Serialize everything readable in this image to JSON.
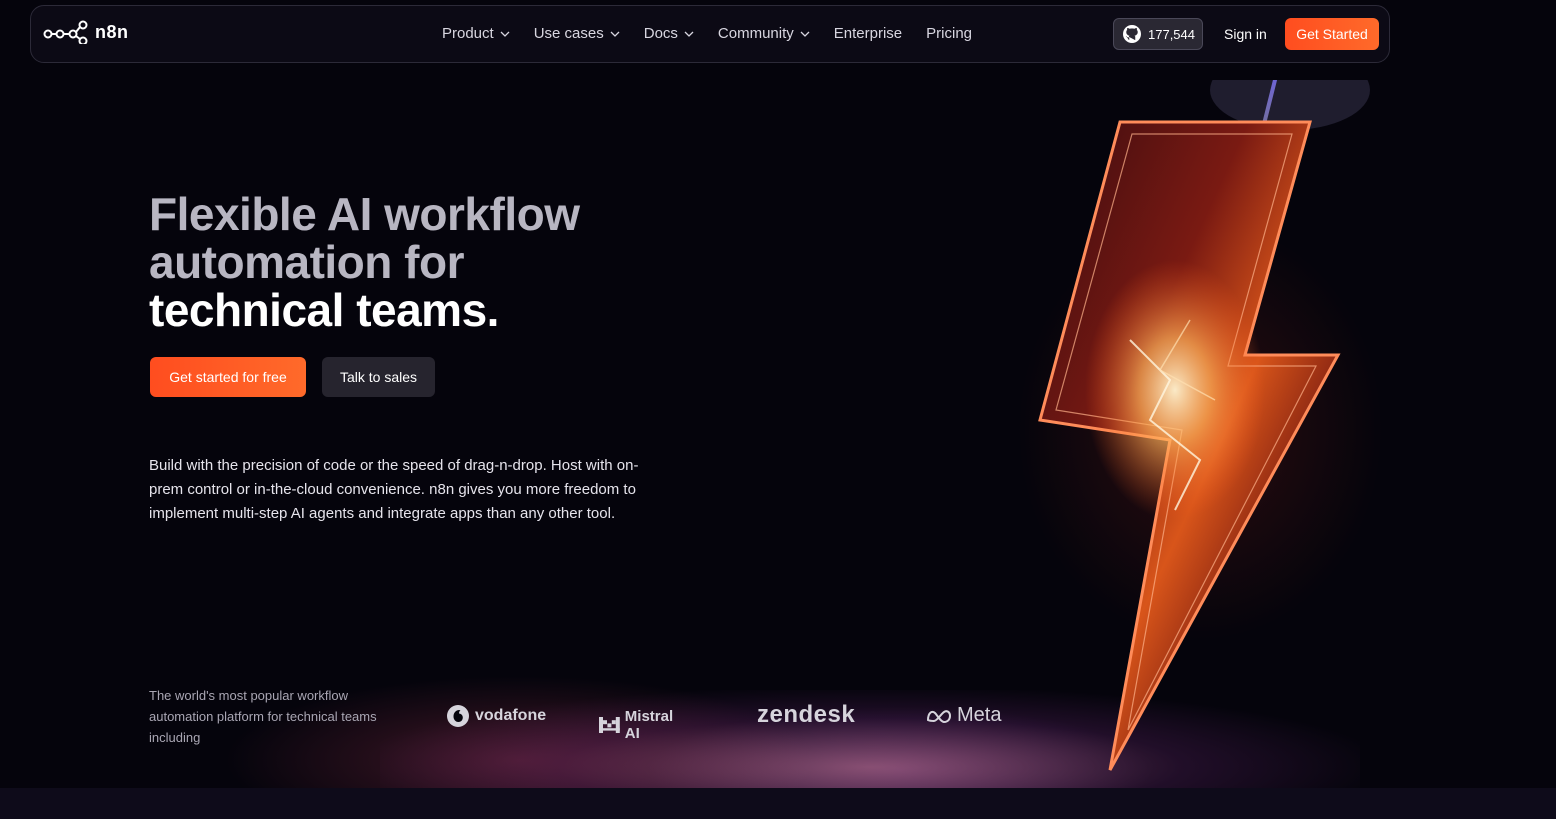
{
  "nav": {
    "logo_text": "n8n",
    "links": [
      {
        "label": "Product"
      },
      {
        "label": "Use cases"
      },
      {
        "label": "Docs"
      },
      {
        "label": "Community"
      },
      {
        "label": "Enterprise"
      },
      {
        "label": "Pricing"
      }
    ],
    "github_stars": "177,544",
    "sign_in": "Sign in",
    "get_started": "Get Started"
  },
  "hero": {
    "headline_line1": "Flexible AI workflow",
    "headline_line2": "automation for",
    "headline_line3": "technical teams.",
    "cta_primary": "Get started for free",
    "cta_secondary": "Talk to sales",
    "description": "Build with the precision of code or the speed of drag-n-drop. Host with on-prem control or in-the-cloud convenience. n8n gives you more freedom to implement multi-step AI agents and integrate apps than any other tool."
  },
  "trusted": {
    "text": "The world's most popular workflow automation platform for technical teams including",
    "logos": [
      {
        "name": "vodafone",
        "icon": "vodafone-icon"
      },
      {
        "name": "Mistral AI",
        "icon": "mistral-icon"
      },
      {
        "name": "zendesk"
      },
      {
        "name": "Meta",
        "icon": "meta-icon"
      }
    ]
  },
  "colors": {
    "accent": "#ff5a24",
    "background": "#05040c"
  }
}
